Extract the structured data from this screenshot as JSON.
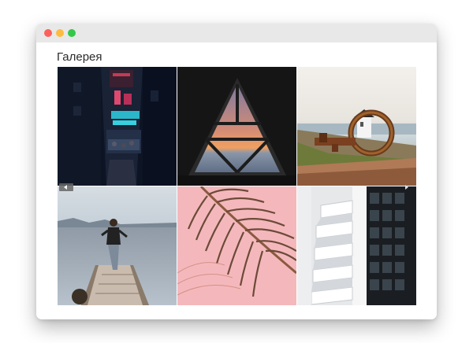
{
  "window": {
    "title": "Галерея"
  },
  "gallery": {
    "images": [
      {
        "name": "neon-street-night"
      },
      {
        "name": "triangle-window-sunset"
      },
      {
        "name": "rusty-key-lighthouse"
      },
      {
        "name": "woman-on-pier"
      },
      {
        "name": "palm-leaf-pink"
      },
      {
        "name": "white-building-stairs"
      }
    ]
  },
  "colors": {
    "titlebar": "#e8e8e8",
    "close": "#fc605c",
    "minimize": "#fdbc40",
    "zoom": "#34c84a"
  }
}
